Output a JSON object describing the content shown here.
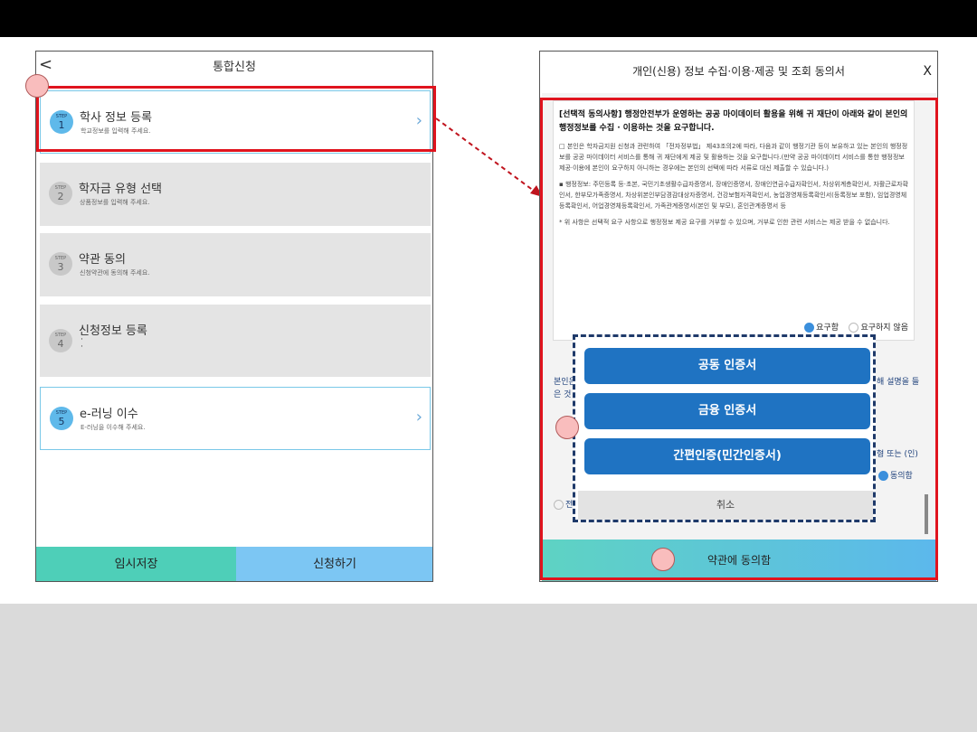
{
  "left_screen": {
    "header_title": "통합신청",
    "back_label": "<",
    "steps": [
      {
        "step_label": "STEP",
        "number": "1",
        "title": "학사 정보 등록",
        "subtitle": "학교정보를 입력해 주세요."
      },
      {
        "step_label": "STEP",
        "number": "2",
        "title": "학자금 유형 선택",
        "subtitle": "상품정보를 입력해 주세요."
      },
      {
        "step_label": "STEP",
        "number": "3",
        "title": "약관 동의",
        "subtitle": "신청약관에 동의해 주세요."
      },
      {
        "step_label": "STEP",
        "number": "4",
        "title": "신청정보 등록",
        "subtitle": "·\n·"
      },
      {
        "step_label": "STEP",
        "number": "5",
        "title": "e-러닝 이수",
        "subtitle": "E-러닝을 이수해 주세요."
      }
    ],
    "save_button": "임시저장",
    "apply_button": "신청하기"
  },
  "right_screen": {
    "title": "개인(신용) 정보 수집·이용·제공 및 조회 동의서",
    "close_label": "X",
    "consent_heading": "[선택적 동의사항] 행정안전부가 운영하는 공공 마이데이터 활용을 위해 귀 재단이 아래와 같이 본인의 행정정보를 수집 · 이용하는 것을 요구합니다.",
    "consent_p1": "□ 본인은 학자금지원 신청과 관련하여 「전자정부법」 제43조의2에 따라, 다음과 같이 행정기관 등이 보유하고 있는 본인의 행정정보를 공공 마이데이터 서비스를 통해 귀 재단에게 제공 및 활용하는 것을 요구합니다.(만약 공공 마이데이터 서비스를 통한 행정정보 제공·이용에 본인이 요구하지 아니하는 경우에는 본인의 선택에 따라 서류로 대신 제출할 수 있습니다.)",
    "consent_p2": "▪ 행정정보: 주민등록 등·초본, 국민기초생활수급자증명서, 장애인증명서, 장애인연금수급자확인서, 차상위계층확인서, 자활근로자확인서, 한부모가족증명서, 차상위본인부담경감대상자증명서, 건강보험자격확인서, 농업경영체등록확인서(등록정보 포함), 임업경영체등록확인서, 어업경영체등록확인서, 가족관계증명서(본인 및 부모), 혼인관계증명서 등",
    "consent_p3": "* 위 사항은 선택적 요구 사항으로 행정정보 제공 요구를 거부할 수 있으며, 거부로 인한 관련 서비스는 제공 받을 수 없습니다.",
    "option_request": "요구함",
    "option_not_request": "요구하지 않음",
    "frag_left_1": "본인은",
    "frag_left_2": "은 것",
    "frag_right_1": "해 설명을 들",
    "frag_right_2": "형 또는 (인)",
    "frag_agree": "동의함",
    "frag_all": "전",
    "agree_button": "약관에 동의함"
  },
  "cert_popup": {
    "buttons": [
      "공동 인증서",
      "금융 인증서",
      "간편인증(민간인증서)"
    ],
    "cancel": "취소"
  },
  "colors": {
    "accent_red": "#e0141e",
    "cert_blue": "#1f73c2",
    "teal": "#4ecfb8",
    "sky": "#7cc6f3"
  }
}
